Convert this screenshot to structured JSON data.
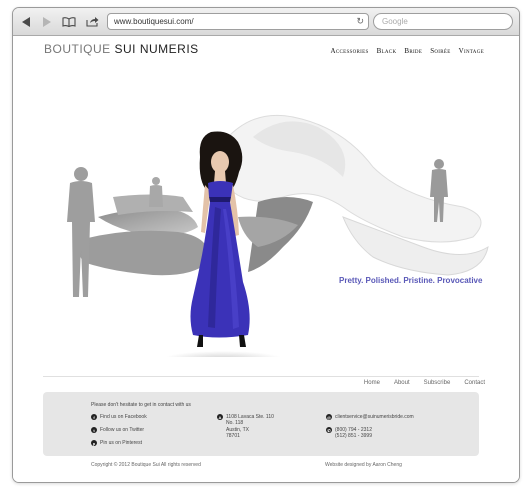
{
  "browser": {
    "url": "www.boutiquesui.com/",
    "search_placeholder": "Google"
  },
  "site": {
    "logo_part1": "BOUTIQUE ",
    "logo_part2": "SUI NUMERIS",
    "nav": [
      "Accessories",
      "Black",
      "Bride",
      "Soirée",
      "Vintage"
    ],
    "tagline": "Pretty. Polished. Pristine. Provocative",
    "footer_nav": [
      "Home",
      "About",
      "Subscribe",
      "Contact"
    ],
    "contact_intro": "Please don't hesitate to get in contact with us",
    "social": [
      {
        "icon": "f",
        "label": "Find us on Facebook"
      },
      {
        "icon": "t",
        "label": "Follow us on Twitter"
      },
      {
        "icon": "p",
        "label": "Pin us on Pinterest"
      }
    ],
    "address": [
      "1108 Lavaca Ste. 110",
      "No. 118",
      "Austin, TX",
      "78701"
    ],
    "email": "clientservice@suinumerisbride.com",
    "phones": [
      "(800) 794 - 2312",
      "(512) 851 - 3999"
    ],
    "copyright": "Copyright © 2012 Boutique Sui All rights reserved",
    "designed_by": "Website designed by  Aaron Cheng"
  },
  "colors": {
    "accent": "#5a59b8",
    "dress": "#3b32b8"
  }
}
